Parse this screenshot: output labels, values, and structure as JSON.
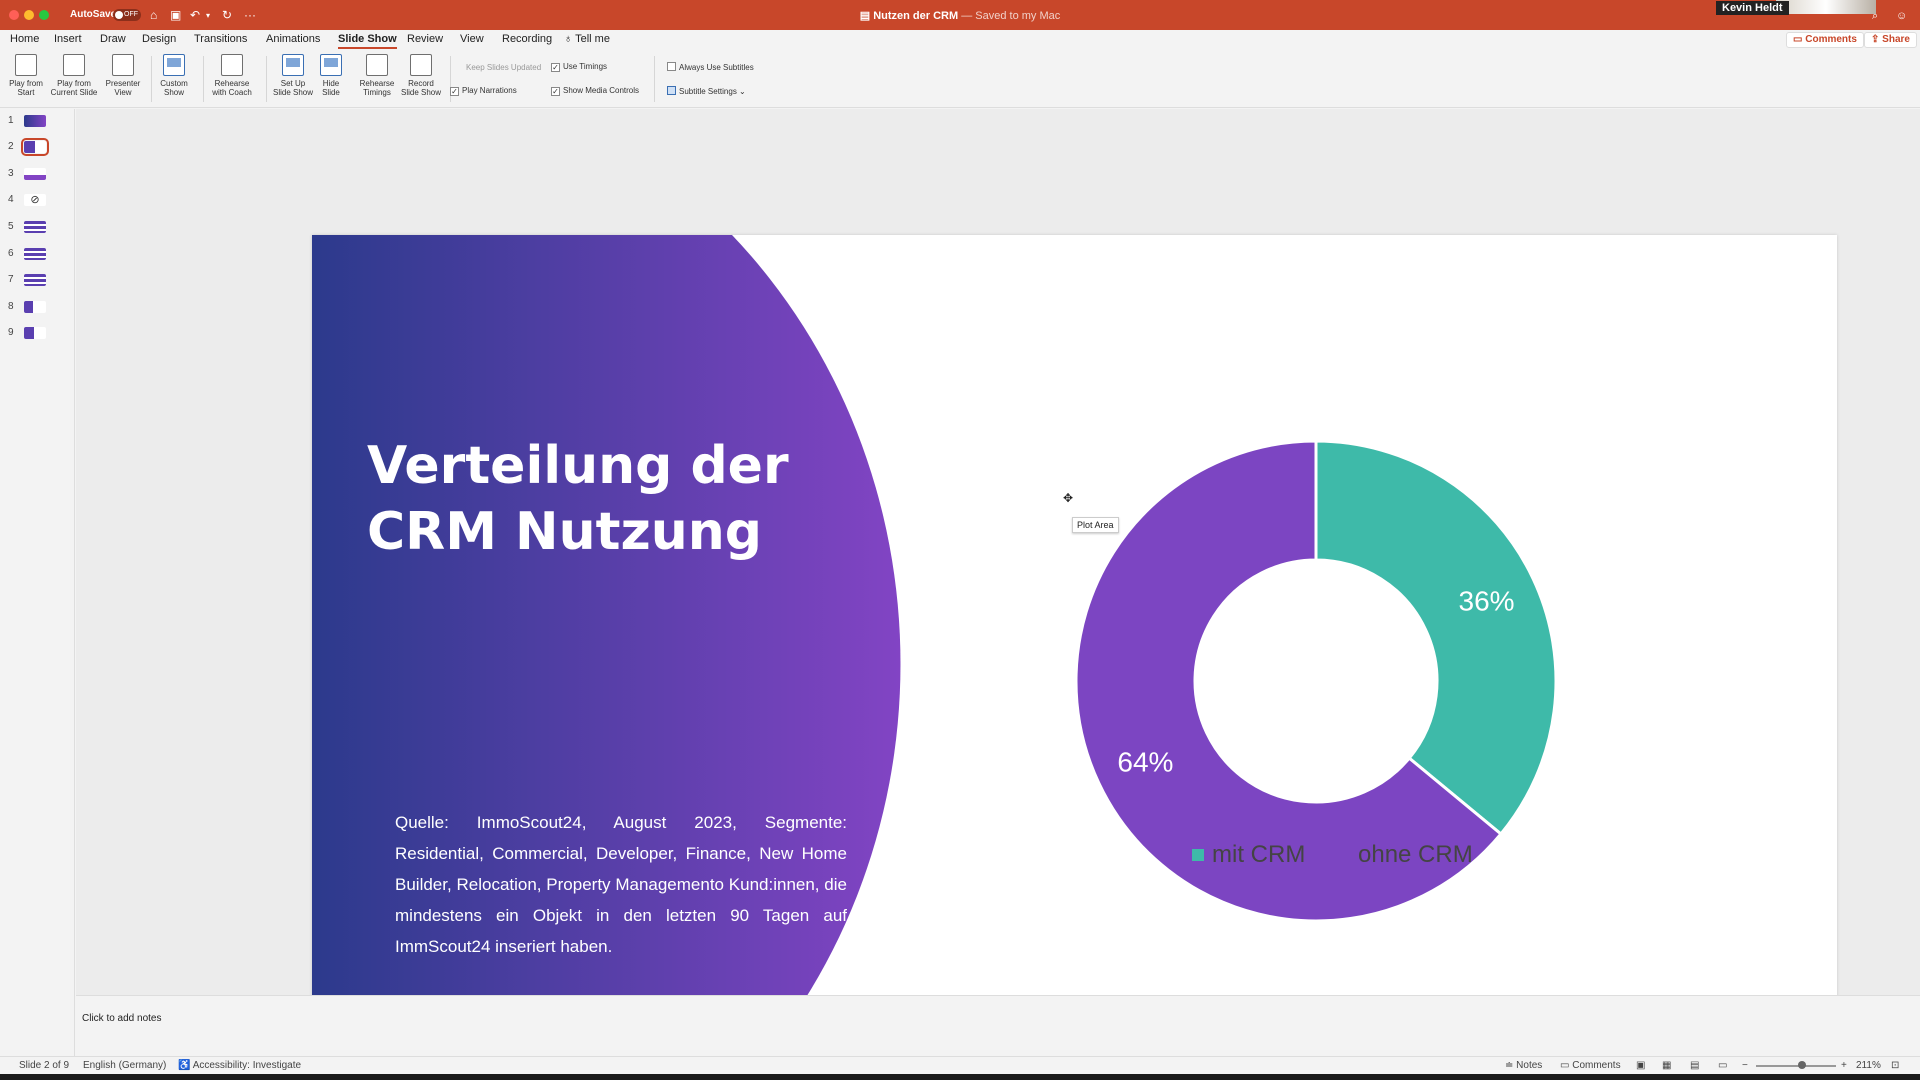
{
  "titlebar": {
    "autosave_label": "AutoSave",
    "autosave_state": "OFF",
    "doc_name": "Nutzen der CRM",
    "doc_status": "— Saved to my Mac",
    "user_name": "Kevin Heldt",
    "colors": {
      "brand": "#c8472a"
    }
  },
  "menu": {
    "tabs": [
      "Home",
      "Insert",
      "Draw",
      "Design",
      "Transitions",
      "Animations",
      "Slide Show",
      "Review",
      "View",
      "Recording"
    ],
    "active_tab": "Slide Show",
    "tell_me": "Tell me",
    "comments": "Comments",
    "share": "Share"
  },
  "ribbon": {
    "buttons": [
      {
        "label": "Play from\nStart",
        "icon": "play-from-start-icon"
      },
      {
        "label": "Play from\nCurrent Slide",
        "icon": "play-current-icon"
      },
      {
        "label": "Presenter\nView",
        "icon": "presenter-view-icon"
      },
      {
        "label": "Custom\nShow",
        "icon": "custom-show-icon"
      },
      {
        "label": "Rehearse\nwith Coach",
        "icon": "rehearse-coach-icon"
      },
      {
        "label": "Set Up\nSlide Show",
        "icon": "setup-show-icon"
      },
      {
        "label": "Hide\nSlide",
        "icon": "hide-slide-icon"
      },
      {
        "label": "Rehearse\nTimings",
        "icon": "rehearse-timings-icon"
      },
      {
        "label": "Record\nSlide Show",
        "icon": "record-show-icon"
      }
    ],
    "keep_slides_updated": "Keep Slides Updated",
    "use_timings": "Use Timings",
    "play_narrations": "Play Narrations",
    "show_media_controls": "Show Media Controls",
    "always_use_subtitles": "Always Use Subtitles",
    "subtitle_settings": "Subtitle Settings"
  },
  "thumbnails": [
    {
      "num": "1"
    },
    {
      "num": "2"
    },
    {
      "num": "3"
    },
    {
      "num": "4"
    },
    {
      "num": "5"
    },
    {
      "num": "6"
    },
    {
      "num": "7"
    },
    {
      "num": "8"
    },
    {
      "num": "9"
    }
  ],
  "slide": {
    "title_line1": "Verteilung der",
    "title_line2": "CRM Nutzung",
    "source_text": "Quelle: ImmoScout24, August 2023, Segmente: Residential, Commercial, Developer, Finance, New Home Builder, Relocation, Property Managemento Kund:innen, die mindestens ein Objekt in den letzten 90 Tagen auf ImmScout24 inseriert haben.",
    "tooltip": "Plot Area",
    "colors": {
      "gradient_start": "#2c3a8c",
      "gradient_end": "#8244c4"
    }
  },
  "chart_data": {
    "type": "pie",
    "donut": true,
    "categories": [
      "mit CRM",
      "ohne CRM"
    ],
    "values": [
      36,
      64
    ],
    "labels": [
      "36%",
      "64%"
    ],
    "colors": [
      "#3ebaa9",
      "#7c45c2"
    ],
    "legend": "bottom"
  },
  "notes": {
    "placeholder": "Click to add notes"
  },
  "status": {
    "slide_info": "Slide 2 of 9",
    "language": "English (Germany)",
    "accessibility": "Accessibility: Investigate",
    "notes": "Notes",
    "comments": "Comments",
    "zoom": "211%"
  }
}
